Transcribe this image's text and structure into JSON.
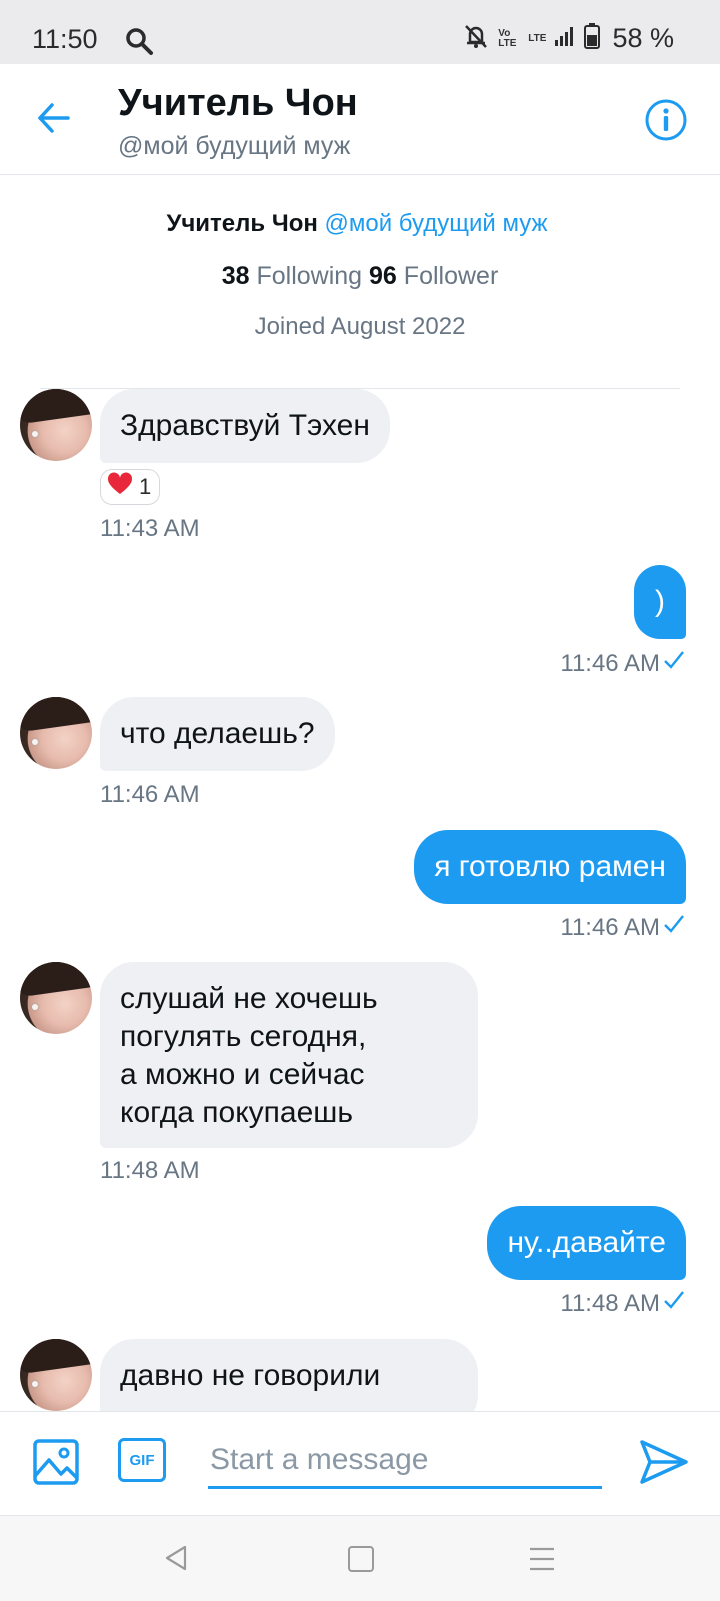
{
  "status_bar": {
    "time": "11:50",
    "battery_percent": "58 %",
    "lte_label": "Vo LTE",
    "lte2_label": "LTE"
  },
  "header": {
    "title": "Учитель Чон",
    "handle": "@мой будущий муж"
  },
  "profile_summary": {
    "name": "Учитель Чон",
    "handle": "@мой будущий муж",
    "following_count": "38",
    "following_label": "Following",
    "follower_count": "96",
    "follower_label": "Follower",
    "joined": "Joined August 2022"
  },
  "messages": [
    {
      "direction": "in",
      "text": "Здравствуй Тэхен",
      "time": "11:43 AM",
      "reaction_emoji": "heart",
      "reaction_count": "1"
    },
    {
      "direction": "out",
      "text": ")",
      "time": "11:46 AM"
    },
    {
      "direction": "in",
      "text": "что делаешь?",
      "time": "11:46 AM"
    },
    {
      "direction": "out",
      "text": "я готовлю рамен",
      "time": "11:46 AM"
    },
    {
      "direction": "in",
      "text": "слушай не хочешь\nпогулять сегодня,\nа можно и сейчас\nкогда покупаешь",
      "time": "11:48 AM"
    },
    {
      "direction": "out",
      "text": "ну..давайте",
      "time": "11:48 AM"
    },
    {
      "direction": "in",
      "text": "давно не говорили"
    }
  ],
  "composer": {
    "placeholder": "Start a message",
    "gif_label": "GIF"
  },
  "colors": {
    "accent": "#1d9bf0",
    "incoming_bubble": "#eef0f3",
    "muted_text": "#687684"
  }
}
